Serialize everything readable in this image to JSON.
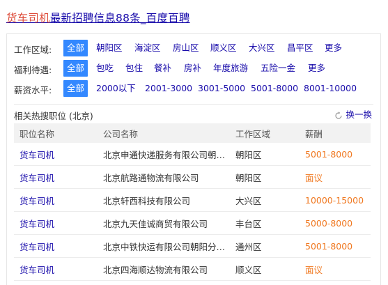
{
  "header": {
    "title_highlight": "货车司机",
    "title_rest": "最新招聘信息88条_百度百聘"
  },
  "filters": [
    {
      "label": "工作区域:",
      "options": [
        "全部",
        "朝阳区",
        "海淀区",
        "房山区",
        "顺义区",
        "大兴区",
        "昌平区",
        "更多"
      ],
      "selected": 0
    },
    {
      "label": "福利待遇:",
      "options": [
        "全部",
        "包吃",
        "包住",
        "餐补",
        "房补",
        "年度旅游",
        "五险一金",
        "更多"
      ],
      "selected": 0
    },
    {
      "label": "薪资水平:",
      "options": [
        "全部",
        "2000以下",
        "2001-3000",
        "3001-5000",
        "5001-8000",
        "8001-10000"
      ],
      "selected": 0
    }
  ],
  "related": {
    "label": "相关热搜职位 (北京)",
    "refresh_label": "换一换"
  },
  "table": {
    "headers": [
      "职位名称",
      "公司名称",
      "工作区域",
      "薪酬"
    ],
    "rows": [
      {
        "job": "货车司机",
        "company": "北京申通快递服务有限公司朝…",
        "area": "朝阳区",
        "pay": "5001-8000"
      },
      {
        "job": "货车司机",
        "company": "北京航路通物流有限公司",
        "area": "朝阳区",
        "pay": "面议"
      },
      {
        "job": "货车司机",
        "company": "北京轩西科技有限公司",
        "area": "大兴区",
        "pay": "10000-15000"
      },
      {
        "job": "货车司机",
        "company": "北京九天佳诚商贸有限公司",
        "area": "丰台区",
        "pay": "5000-8000"
      },
      {
        "job": "货车司机",
        "company": "北京中铁快运有限公司朝阳分…",
        "area": "通州区",
        "pay": "5001-8000"
      },
      {
        "job": "货车司机",
        "company": "北京四海顺达物流有限公司",
        "area": "顺义区",
        "pay": "面议"
      }
    ]
  },
  "colors": {
    "link": "#1a0dab",
    "highlight": "#dd4b39",
    "selected_bg": "#3388ff",
    "pay": "#f07820"
  }
}
